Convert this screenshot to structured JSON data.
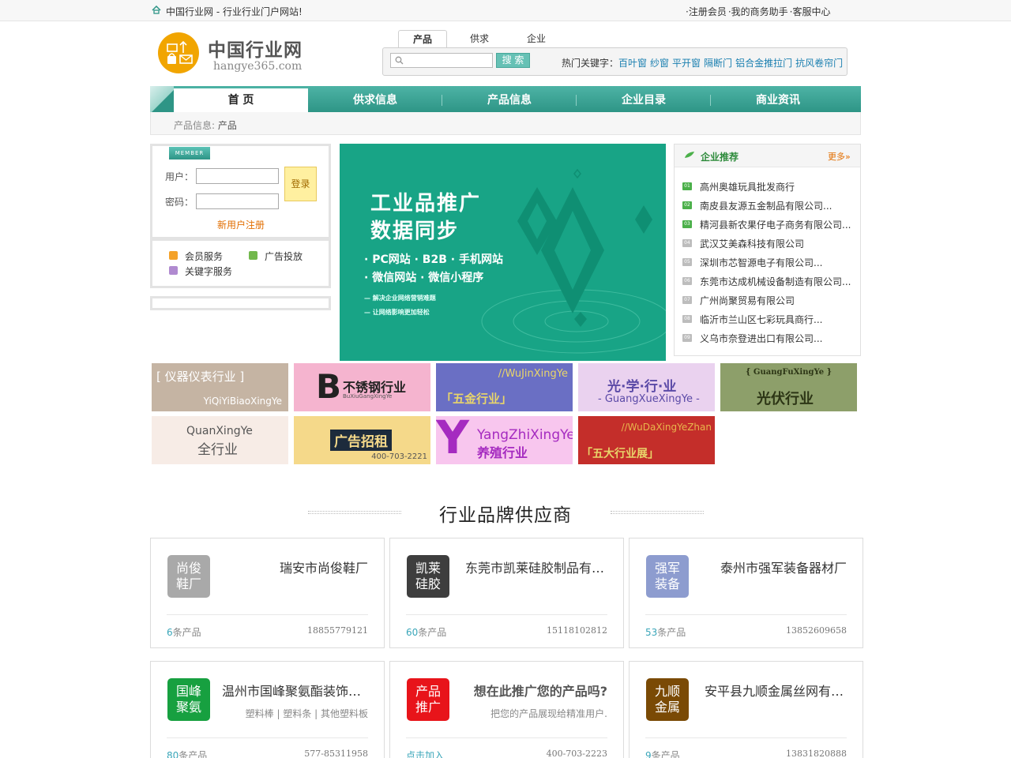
{
  "topbar": {
    "slogan": "中国行业网 - 行业行业门户网站!",
    "links": [
      "·注册会员",
      "·我的商务助手",
      "·客服中心"
    ]
  },
  "header": {
    "logo_title": "中国行业网",
    "logo_sub": "hangye365.com"
  },
  "search": {
    "tabs": [
      "产品",
      "供求",
      "企业"
    ],
    "active_tab": "产品",
    "input_value": "",
    "button": "搜 索",
    "hot_label": "热门关键字：",
    "hot_keywords": [
      "百叶窗",
      "纱窗",
      "平开窗",
      "隔断门",
      "铝合金推拉门",
      "抗风卷帘门"
    ]
  },
  "nav": {
    "items": [
      "首 页",
      "供求信息",
      "产品信息",
      "企业目录",
      "商业资讯"
    ],
    "active": "首 页"
  },
  "breadcrumb": {
    "prefix": "产品信息:",
    "current": "产品"
  },
  "login": {
    "badge": "MEMBER",
    "user_label": "用户：",
    "pass_label": "密码：",
    "user_value": "",
    "pass_value": "",
    "button": "登录",
    "register": "新用户注册",
    "services": [
      "会员服务",
      "广告投放",
      "关键字服务"
    ]
  },
  "banner": {
    "headline1": "工业品推广",
    "headline2": "数据同步",
    "line1": "· PC网站 · B2B · 手机网站",
    "line2": "· 微信网站 · 微信小程序",
    "small1": "— 解决企业网络营销难题",
    "small2": "— 让网络影响更加轻松"
  },
  "recommend": {
    "title": "企业推荐",
    "more": "更多»",
    "items": [
      {
        "num": "01",
        "name": "高州奥雄玩具批发商行"
      },
      {
        "num": "02",
        "name": "南皮县友源五金制品有限公司..."
      },
      {
        "num": "03",
        "name": "精河县新农果仔电子商务有限公司..."
      },
      {
        "num": "04",
        "name": "武汉艾美森科技有限公司"
      },
      {
        "num": "05",
        "name": "深圳市芯智源电子有限公司..."
      },
      {
        "num": "06",
        "name": "东莞市达成机械设备制造有限公司..."
      },
      {
        "num": "07",
        "name": "广州尚聚贸易有限公司"
      },
      {
        "num": "08",
        "name": "临沂市兰山区七彩玩具商行..."
      },
      {
        "num": "09",
        "name": "义乌市奈登进出口有限公司..."
      }
    ]
  },
  "tiles": [
    {
      "main": "[ 仪器仪表行业 ]",
      "sub": "YiQiYiBiaoXingYe"
    },
    {
      "main": "不锈钢行业",
      "sub": "BuXiuGangXingYe",
      "letter": "B"
    },
    {
      "main": "「五金行业」",
      "sub": "//WuJinXingYe"
    },
    {
      "main": "光·学·行·业",
      "sub": "- GuangXueXingYe -"
    },
    {
      "main": "光伏行业",
      "sub": "{ GuangFuXingYe }"
    },
    {
      "main": "全行业",
      "sub": "QuanXingYe"
    },
    {
      "main": "广告招租",
      "sub": "400-703-2221"
    },
    {
      "main": "养殖行业",
      "sub": "YangZhiXingYe",
      "letter": "Y"
    },
    {
      "main": "「五大行业展」",
      "sub": "//WuDaXingYeZhan"
    }
  ],
  "section": {
    "title": "行业品牌供应商"
  },
  "suppliers": [
    {
      "avatar": [
        "尚俊",
        "鞋厂"
      ],
      "color": "#a9a9a9",
      "name": "瑞安市尚俊鞋厂",
      "sub": "",
      "count": "6",
      "count_suffix": "条产品",
      "phone": "18855779121"
    },
    {
      "avatar": [
        "凯莱",
        "硅胶"
      ],
      "color": "#3e3e3e",
      "name": "东莞市凯莱硅胶制品有限公司",
      "sub": "",
      "count": "60",
      "count_suffix": "条产品",
      "phone": "15118102812"
    },
    {
      "avatar": [
        "强军",
        "装备"
      ],
      "color": "#8d9ccf",
      "name": "泰州市强军装备器材厂",
      "sub": "",
      "count": "53",
      "count_suffix": "条产品",
      "phone": "13852609658"
    },
    {
      "avatar": [
        "国峰",
        "聚氨"
      ],
      "color": "#17a040",
      "name": "温州市国峰聚氨酯装饰材料有限公司",
      "sub": "塑料棒 | 塑料条 | 其他塑料板",
      "count": "80",
      "count_suffix": "条产品",
      "phone": "577-85311958"
    },
    {
      "avatar": [
        "产品",
        "推广"
      ],
      "color": "#e8141a",
      "name": "想在此推广您的产品吗?",
      "sub": "把您的产品展现给精准用户.",
      "count": "点击加入",
      "count_suffix": "",
      "phone": "400-703-2223"
    },
    {
      "avatar": [
        "九顺",
        "金属"
      ],
      "color": "#7a4a05",
      "name": "安平县九顺金属丝网有限公司",
      "sub": "",
      "count": "9",
      "count_suffix": "条产品",
      "phone": "13831820888"
    }
  ],
  "colors": {
    "accent": "#2e9586",
    "orange": "#e26e00",
    "link": "#1a7fb0"
  }
}
